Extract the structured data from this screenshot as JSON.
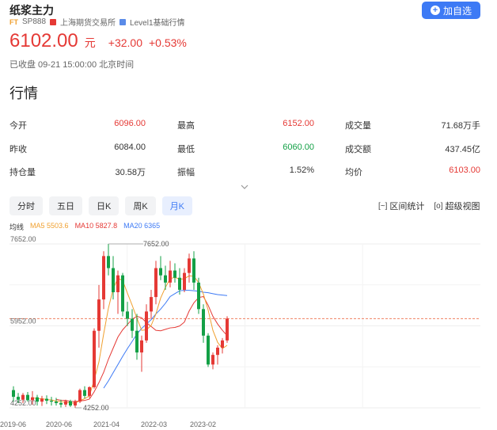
{
  "header": {
    "title": "纸浆主力",
    "ft_label": "FT",
    "code": "SP888",
    "exchange": "上海期货交易所",
    "level": "Level1基础行情",
    "add_button": "加自选",
    "exchange_color": "#e53935",
    "level_color": "#5a8be8",
    "accent": "#3d7af5"
  },
  "quote": {
    "price": "6102.00",
    "unit": "元",
    "change": "+32.00",
    "change_pct": "+0.53%",
    "status": "已收盘 09-21 15:00:00 北京时间"
  },
  "section_title": "行情",
  "stats": [
    [
      {
        "label": "今开",
        "value": "6096.00",
        "color": "red"
      },
      {
        "label": "最高",
        "value": "6152.00",
        "color": "red"
      },
      {
        "label": "成交量",
        "value": "71.68万手",
        "color": "dark"
      }
    ],
    [
      {
        "label": "昨收",
        "value": "6084.00",
        "color": "dark"
      },
      {
        "label": "最低",
        "value": "6060.00",
        "color": "green"
      },
      {
        "label": "成交额",
        "value": "437.45亿",
        "color": "dark"
      }
    ],
    [
      {
        "label": "持仓量",
        "value": "30.58万",
        "color": "dark"
      },
      {
        "label": "振幅",
        "value": "1.52%",
        "color": "dark"
      },
      {
        "label": "均价",
        "value": "6103.00",
        "color": "red"
      }
    ]
  ],
  "tabs": [
    "分时",
    "五日",
    "日K",
    "周K",
    "月K"
  ],
  "active_tab": 4,
  "tools": {
    "interval_icon": "[~]",
    "interval": "区间统计",
    "super_icon": "[o]",
    "super": "超级视图"
  },
  "legend": {
    "avg": "均线",
    "ma5": "MA5 5503.6",
    "ma10": "MA10 5827.8",
    "ma20": "MA20 6365",
    "ma5_color": "#f0a030",
    "ma10_color": "#e53935",
    "ma20_color": "#3d7af5"
  },
  "chart_data": {
    "type": "candlestick",
    "y_ticks": [
      "7652.00",
      "5952.00",
      "4252.00"
    ],
    "y_values": [
      7652,
      5952,
      4252
    ],
    "x_ticks": [
      "2019-06",
      "2020-06",
      "2021-04",
      "2022-03",
      "2023-02"
    ],
    "max_label": "7652.00",
    "min_label": "4252.00",
    "current_price": 6102,
    "up_color": "#e53935",
    "down_color": "#13a046",
    "candles": [
      {
        "o": 4620,
        "h": 4700,
        "l": 4380,
        "c": 4480
      },
      {
        "o": 4480,
        "h": 4560,
        "l": 4350,
        "c": 4420
      },
      {
        "o": 4420,
        "h": 4560,
        "l": 4350,
        "c": 4520
      },
      {
        "o": 4520,
        "h": 4580,
        "l": 4380,
        "c": 4410
      },
      {
        "o": 4410,
        "h": 4600,
        "l": 4320,
        "c": 4470
      },
      {
        "o": 4470,
        "h": 4520,
        "l": 4300,
        "c": 4380
      },
      {
        "o": 4380,
        "h": 4500,
        "l": 4290,
        "c": 4440
      },
      {
        "o": 4440,
        "h": 4510,
        "l": 4330,
        "c": 4400
      },
      {
        "o": 4400,
        "h": 4480,
        "l": 4300,
        "c": 4380
      },
      {
        "o": 4380,
        "h": 4460,
        "l": 4300,
        "c": 4350
      },
      {
        "o": 4350,
        "h": 4420,
        "l": 4260,
        "c": 4320
      },
      {
        "o": 4320,
        "h": 4420,
        "l": 4270,
        "c": 4390
      },
      {
        "o": 4390,
        "h": 4420,
        "l": 4270,
        "c": 4300
      },
      {
        "o": 4300,
        "h": 4420,
        "l": 4252,
        "c": 4380
      },
      {
        "o": 4380,
        "h": 4650,
        "l": 4350,
        "c": 4620
      },
      {
        "o": 4620,
        "h": 4700,
        "l": 4450,
        "c": 4500
      },
      {
        "o": 4500,
        "h": 4700,
        "l": 4460,
        "c": 4680
      },
      {
        "o": 4680,
        "h": 5900,
        "l": 4650,
        "c": 5850
      },
      {
        "o": 5850,
        "h": 6800,
        "l": 5500,
        "c": 6500
      },
      {
        "o": 6500,
        "h": 7500,
        "l": 6300,
        "c": 7400
      },
      {
        "o": 7400,
        "h": 7652,
        "l": 7000,
        "c": 7150
      },
      {
        "o": 7150,
        "h": 7400,
        "l": 6500,
        "c": 6650
      },
      {
        "o": 6650,
        "h": 7100,
        "l": 6200,
        "c": 7000
      },
      {
        "o": 7000,
        "h": 7050,
        "l": 6150,
        "c": 6250
      },
      {
        "o": 6250,
        "h": 6450,
        "l": 5950,
        "c": 6100
      },
      {
        "o": 6100,
        "h": 6300,
        "l": 5700,
        "c": 5850
      },
      {
        "o": 5850,
        "h": 6200,
        "l": 5250,
        "c": 5400
      },
      {
        "o": 5400,
        "h": 5750,
        "l": 5000,
        "c": 5650
      },
      {
        "o": 5650,
        "h": 6400,
        "l": 5600,
        "c": 6250
      },
      {
        "o": 6250,
        "h": 6700,
        "l": 6100,
        "c": 6550
      },
      {
        "o": 6550,
        "h": 7300,
        "l": 6400,
        "c": 7150
      },
      {
        "o": 7150,
        "h": 7400,
        "l": 6900,
        "c": 7000
      },
      {
        "o": 7000,
        "h": 7200,
        "l": 6700,
        "c": 6850
      },
      {
        "o": 6850,
        "h": 7300,
        "l": 6750,
        "c": 7100
      },
      {
        "o": 7100,
        "h": 7250,
        "l": 6850,
        "c": 6950
      },
      {
        "o": 6950,
        "h": 7150,
        "l": 6600,
        "c": 6700
      },
      {
        "o": 6700,
        "h": 7150,
        "l": 6650,
        "c": 7050
      },
      {
        "o": 7050,
        "h": 7450,
        "l": 6850,
        "c": 7350
      },
      {
        "o": 7350,
        "h": 7500,
        "l": 6700,
        "c": 6850
      },
      {
        "o": 6850,
        "h": 6950,
        "l": 6200,
        "c": 6300
      },
      {
        "o": 6300,
        "h": 6400,
        "l": 5600,
        "c": 5750
      },
      {
        "o": 5750,
        "h": 5800,
        "l": 5100,
        "c": 5150
      },
      {
        "o": 5150,
        "h": 5400,
        "l": 5050,
        "c": 5350
      },
      {
        "o": 5350,
        "h": 5550,
        "l": 5150,
        "c": 5500
      },
      {
        "o": 5500,
        "h": 5700,
        "l": 5380,
        "c": 5650
      },
      {
        "o": 5650,
        "h": 6152,
        "l": 5600,
        "c": 6102
      }
    ],
    "ma5": [
      null,
      null,
      null,
      null,
      4464,
      4440,
      4444,
      4420,
      4418,
      4390,
      4378,
      4368,
      4352,
      4348,
      4402,
      4442,
      4500,
      4830,
      5204,
      5786,
      6320,
      6720,
      6940,
      6890,
      6630,
      6380,
      6110,
      5860,
      5870,
      5960,
      6200,
      6530,
      6750,
      6930,
      6960,
      6920,
      6930,
      6990,
      6980,
      6850,
      6610,
      6280,
      5860,
      5610,
      5480,
      5550
    ],
    "ma10": [
      null,
      null,
      null,
      null,
      null,
      null,
      null,
      null,
      null,
      4427,
      4409,
      4406,
      4386,
      4383,
      4396,
      4405,
      4434,
      4585,
      4775,
      4990,
      5260,
      5490,
      5720,
      5870,
      5980,
      6090,
      6150,
      6120,
      6020,
      5940,
      5860,
      5850,
      5880,
      5910,
      5920,
      5950,
      6030,
      6260,
      6430,
      6540,
      6560,
      6380,
      6150,
      5990,
      5860,
      5750
    ],
    "ma20": [
      null,
      null,
      null,
      null,
      null,
      null,
      null,
      null,
      null,
      null,
      null,
      null,
      null,
      null,
      null,
      null,
      null,
      null,
      null,
      4660,
      4810,
      4980,
      5150,
      5320,
      5480,
      5630,
      5780,
      5900,
      5990,
      6080,
      6200,
      6300,
      6420,
      6560,
      6620,
      6680,
      6690,
      6690,
      6680,
      6670,
      6650,
      6640,
      6620,
      6600,
      6590,
      6580
    ]
  }
}
